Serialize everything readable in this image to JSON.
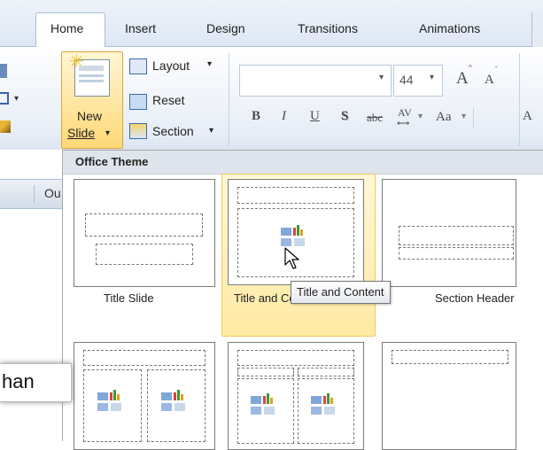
{
  "tabs": [
    {
      "label": "Home",
      "active": true
    },
    {
      "label": "Insert",
      "active": false
    },
    {
      "label": "Design",
      "active": false
    },
    {
      "label": "Transitions",
      "active": false
    },
    {
      "label": "Animations",
      "active": false
    }
  ],
  "slides_group": {
    "new_slide_line1": "New",
    "new_slide_line2": "Slide",
    "layout_label": "Layout",
    "reset_label": "Reset",
    "section_label": "Section"
  },
  "font_group": {
    "font_size": "44",
    "bold": "B",
    "italic": "I",
    "underline": "U",
    "shadow": "S",
    "strikethrough": "abc",
    "char_spacing": "AV",
    "change_case": "Aa",
    "grow_font": "A",
    "shrink_font": "A"
  },
  "left_panel": {
    "outline_tab": "Ou",
    "clipped_text": "han"
  },
  "gallery": {
    "title": "Office Theme",
    "layouts": [
      {
        "label": "Title Slide"
      },
      {
        "label": "Title and Content",
        "hovered": true
      },
      {
        "label": "Section Header"
      },
      {
        "label": ""
      },
      {
        "label": ""
      },
      {
        "label": ""
      }
    ],
    "tooltip": "Title and Content"
  },
  "colors": {
    "accent_hover": "#ffe9a3",
    "tab_border": "#a9bfd6"
  }
}
